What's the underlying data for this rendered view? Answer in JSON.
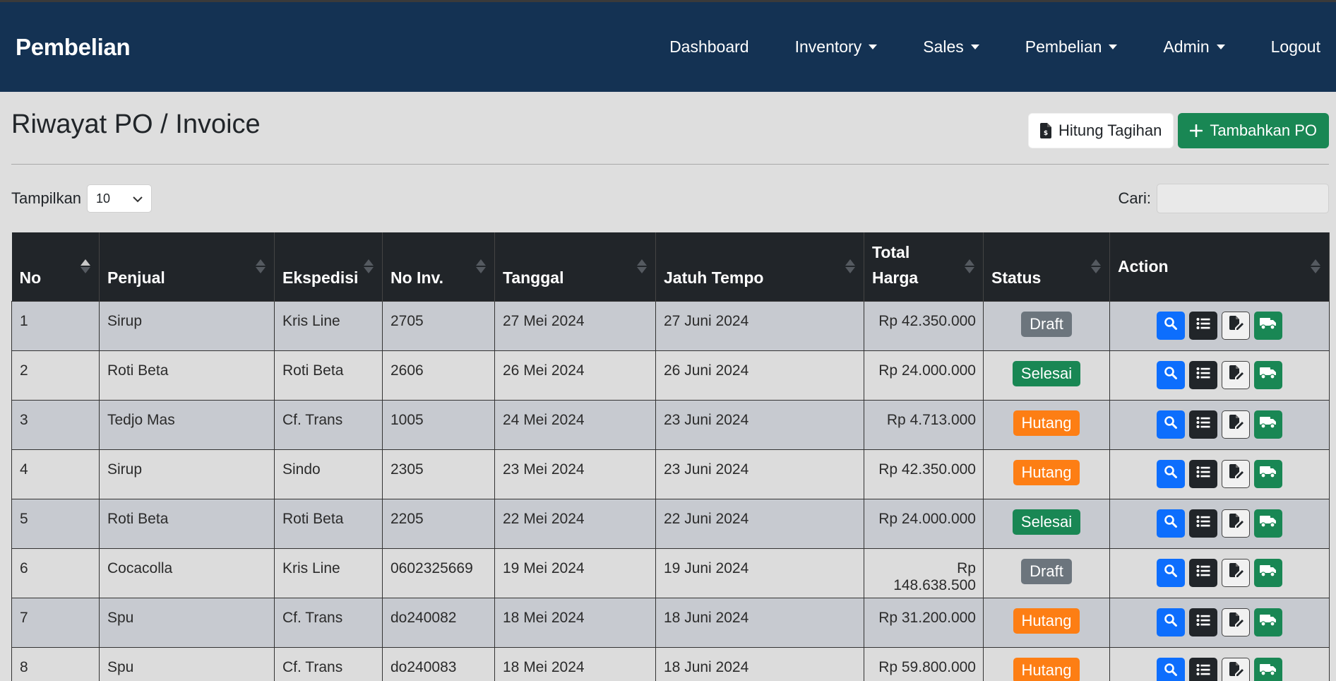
{
  "navbar": {
    "brand": "Pembelian",
    "items": [
      {
        "label": "Dashboard",
        "dropdown": false
      },
      {
        "label": "Inventory",
        "dropdown": true
      },
      {
        "label": "Sales",
        "dropdown": true
      },
      {
        "label": "Pembelian",
        "dropdown": true
      },
      {
        "label": "Admin",
        "dropdown": true
      },
      {
        "label": "Logout",
        "dropdown": false
      }
    ]
  },
  "page": {
    "title": "Riwayat PO / Invoice",
    "hitung_label": "Hitung Tagihan",
    "tambah_label": "Tambahkan PO"
  },
  "controls": {
    "length_label": "Tampilkan",
    "length_value": "10",
    "search_label": "Cari:",
    "search_value": ""
  },
  "table": {
    "columns": [
      "No",
      "Penjual",
      "Ekspedisi",
      "No Inv.",
      "Tanggal",
      "Jatuh Tempo",
      "Total Harga",
      "Status",
      "Action"
    ],
    "rows": [
      {
        "no": "1",
        "penjual": "Sirup",
        "ekspedisi": "Kris Line",
        "inv": "2705",
        "tanggal": "27 Mei 2024",
        "tempo": "27 Juni 2024",
        "total": "Rp 42.350.000",
        "status": "Draft"
      },
      {
        "no": "2",
        "penjual": "Roti Beta",
        "ekspedisi": "Roti Beta",
        "inv": "2606",
        "tanggal": "26 Mei 2024",
        "tempo": "26 Juni 2024",
        "total": "Rp 24.000.000",
        "status": "Selesai"
      },
      {
        "no": "3",
        "penjual": "Tedjo Mas",
        "ekspedisi": "Cf. Trans",
        "inv": "1005",
        "tanggal": "24 Mei 2024",
        "tempo": "23 Juni 2024",
        "total": "Rp 4.713.000",
        "status": "Hutang"
      },
      {
        "no": "4",
        "penjual": "Sirup",
        "ekspedisi": "Sindo",
        "inv": "2305",
        "tanggal": "23 Mei 2024",
        "tempo": "23 Juni 2024",
        "total": "Rp 42.350.000",
        "status": "Hutang"
      },
      {
        "no": "5",
        "penjual": "Roti Beta",
        "ekspedisi": "Roti Beta",
        "inv": "2205",
        "tanggal": "22 Mei 2024",
        "tempo": "22 Juni 2024",
        "total": "Rp 24.000.000",
        "status": "Selesai"
      },
      {
        "no": "6",
        "penjual": "Cocacolla",
        "ekspedisi": "Kris Line",
        "inv": "0602325669",
        "tanggal": "19 Mei 2024",
        "tempo": "19 Juni 2024",
        "total": "Rp 148.638.500",
        "status": "Draft"
      },
      {
        "no": "7",
        "penjual": "Spu",
        "ekspedisi": "Cf. Trans",
        "inv": "do240082",
        "tanggal": "18 Mei 2024",
        "tempo": "18 Juni 2024",
        "total": "Rp 31.200.000",
        "status": "Hutang"
      },
      {
        "no": "8",
        "penjual": "Spu",
        "ekspedisi": "Cf. Trans",
        "inv": "do240083",
        "tanggal": "18 Mei 2024",
        "tempo": "18 Juni 2024",
        "total": "Rp 59.800.000",
        "status": "Hutang"
      }
    ],
    "row_actions": [
      "search-icon",
      "list-icon",
      "file-edit-icon",
      "truck-icon"
    ]
  },
  "colors": {
    "navbar": "#143253",
    "draft": "#6c757d",
    "selesai": "#198754",
    "hutang": "#fd7e14",
    "primary": "#0d6efd"
  }
}
